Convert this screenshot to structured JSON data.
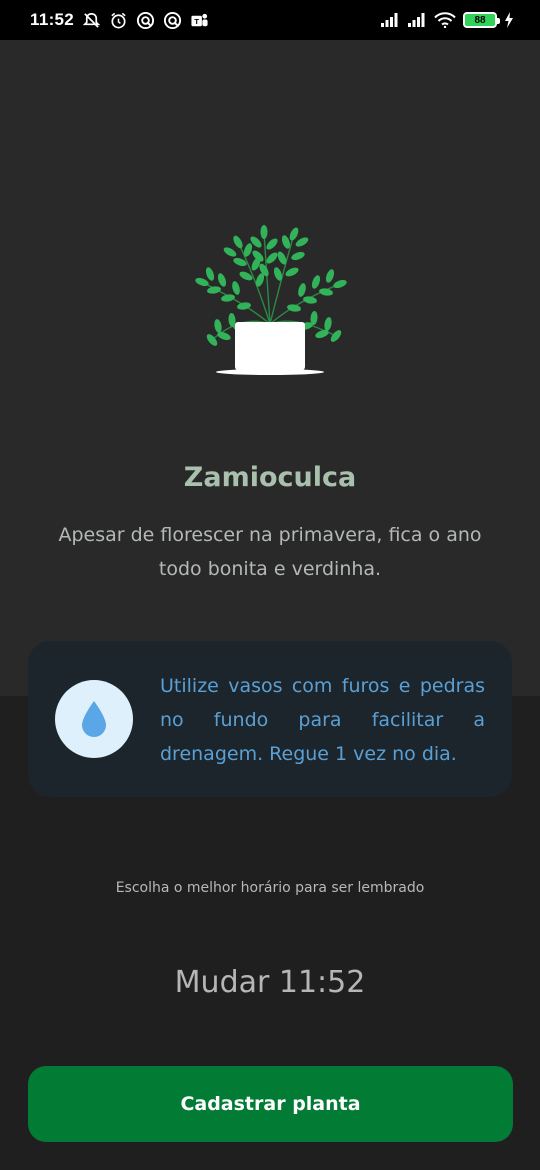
{
  "status_bar": {
    "time": "11:52",
    "battery_level": "88",
    "left_icons": [
      "mute-icon",
      "alarm-icon",
      "app-icon",
      "app-icon",
      "teams-icon"
    ],
    "right_icons": [
      "signal-icon",
      "signal-icon",
      "wifi-icon",
      "battery-icon",
      "charging-icon"
    ]
  },
  "plant": {
    "name": "Zamioculca",
    "about": "Apesar de florescer na primavera, fica o ano todo bonita e verdinha."
  },
  "tip": {
    "icon": "water-drop-icon",
    "text": "Utilize vasos com furos e pedras no fundo para facilitar a drenagem. Regue 1 vez no dia."
  },
  "reminder": {
    "label": "Escolha o melhor horário para ser lembrado",
    "change_time": "Mudar 11:52"
  },
  "actions": {
    "submit_label": "Cadastrar planta"
  },
  "colors": {
    "accent": "#027b35",
    "title": "#a9c0ad",
    "tip_text": "#5aa0d4",
    "leaf": "#32b35a"
  }
}
